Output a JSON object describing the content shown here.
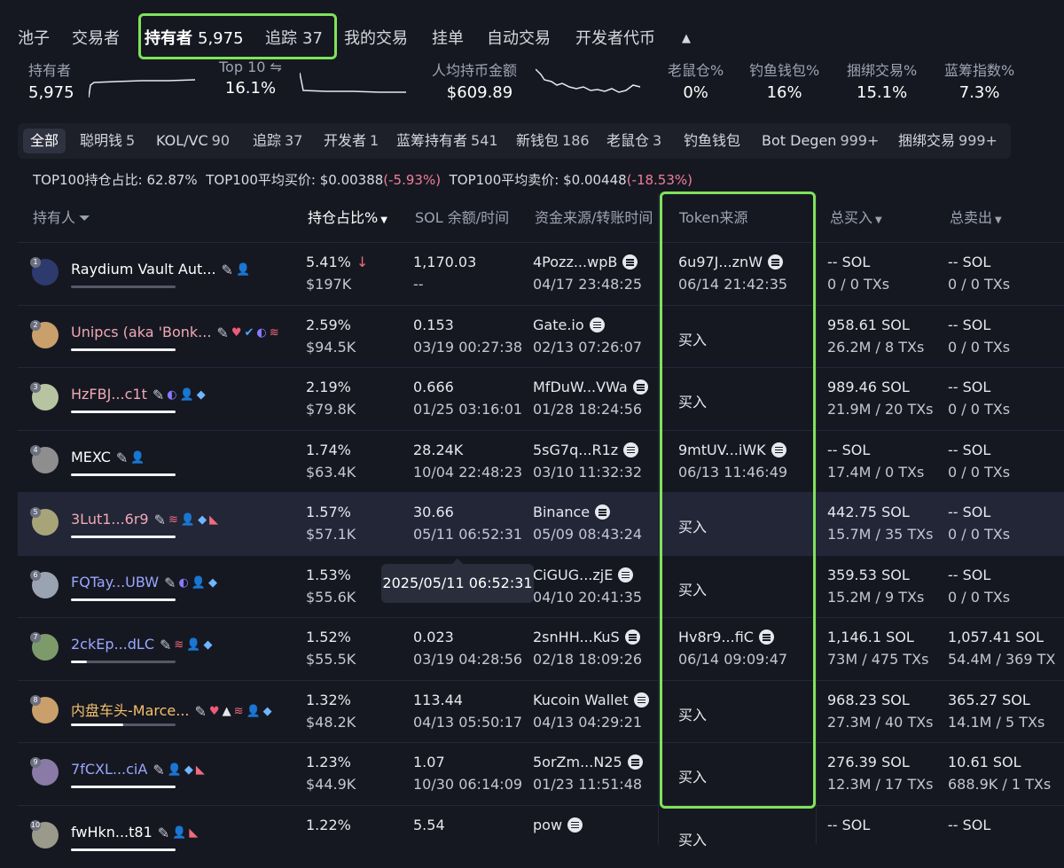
{
  "top_tabs": [
    {
      "label": "池子"
    },
    {
      "label": "交易者"
    },
    {
      "label": "持有者",
      "count": "5,975"
    },
    {
      "label": "追踪",
      "count": "37"
    },
    {
      "label": "我的交易"
    },
    {
      "label": "挂单"
    },
    {
      "label": "自动交易"
    },
    {
      "label": "开发者代币"
    }
  ],
  "stats": {
    "holders": {
      "label": "持有者",
      "value": "5,975"
    },
    "top10": {
      "label": "Top 10 ⇋",
      "value": "16.1%"
    },
    "avg_hold": {
      "label": "人均持币金额",
      "value": "$609.89"
    },
    "rat": {
      "label": "老鼠仓%",
      "value": "0%"
    },
    "phish": {
      "label": "钓鱼钱包%",
      "value": "16%"
    },
    "bundle": {
      "label": "捆绑交易%",
      "value": "15.1%"
    },
    "bluechip": {
      "label": "蓝筹指数%",
      "value": "7.3%"
    }
  },
  "filters": [
    {
      "label": "全部"
    },
    {
      "label": "聪明钱",
      "count": "5"
    },
    {
      "label": "KOL/VC",
      "count": "90"
    },
    {
      "label": "追踪",
      "count": "37"
    },
    {
      "label": "开发者",
      "count": "1"
    },
    {
      "label": "蓝筹持有者",
      "count": "541"
    },
    {
      "label": "新钱包",
      "count": "186"
    },
    {
      "label": "老鼠仓",
      "count": "3"
    },
    {
      "label": "钓鱼钱包"
    },
    {
      "label": "Bot Degen",
      "count": "999+"
    },
    {
      "label": "捆绑交易",
      "count": "999+"
    }
  ],
  "summary": {
    "share_label": "TOP100持仓占比:",
    "share": "62.87%",
    "avg_buy_label": "TOP100平均买价:",
    "avg_buy": "$0.00388",
    "avg_buy_chg": "(-5.93%)",
    "avg_sell_label": "TOP100平均卖价:",
    "avg_sell": "$0.00448",
    "avg_sell_chg": "(-18.53%)"
  },
  "headers": {
    "holder": "持有人",
    "share": "持仓占比%",
    "sol": "SOL 余额/时间",
    "funding": "资金来源/转账时间",
    "token_source": "Token来源",
    "total_buy": "总买入",
    "total_sell": "总卖出"
  },
  "tooltip": "2025/05/11 06:52:31",
  "rows": [
    {
      "rank": "1",
      "name": "Raydium Vault Aut...",
      "name_color": "#ffffff",
      "bar": 0,
      "pct": "5.41%",
      "usd": "$197K",
      "sol": "1,170.03",
      "sol_time": "--",
      "fund": "4Pozz...wpB",
      "fund_time": "04/17 23:48:25",
      "tok": "6u97J...znW",
      "tok_time": "06/14 21:42:35",
      "buy": "-- SOL",
      "buy_sub": "0 / 0 TXs",
      "sell": "-- SOL",
      "sell_sub": "0 / 0 TXs",
      "icons": [
        "person"
      ]
    },
    {
      "rank": "2",
      "name": "Unipcs (aka 'Bonk...",
      "name_color": "#f0a8b6",
      "bar": 1,
      "pct": "2.59%",
      "usd": "$94.5K",
      "sol": "0.153",
      "sol_time": "03/19 00:27:38",
      "fund": "Gate.io",
      "fund_time": "02/13 07:26:07",
      "tok": "买入",
      "tok_time": "",
      "buy": "958.61 SOL",
      "buy_sub": "26.2M / 8 TXs",
      "sell": "-- SOL",
      "sell_sub": "0 / 0 TXs",
      "icons": [
        "heart",
        "verified",
        "moon",
        "stack"
      ]
    },
    {
      "rank": "3",
      "name": "HzFBJ...c1t",
      "name_color": "#f0a8b6",
      "bar": 1,
      "pct": "2.19%",
      "usd": "$79.8K",
      "sol": "0.666",
      "sol_time": "01/25 03:16:01",
      "fund": "MfDuW...VWa",
      "fund_time": "01/28 18:24:56",
      "tok": "买入",
      "tok_time": "",
      "buy": "989.46 SOL",
      "buy_sub": "21.9M / 20 TXs",
      "sell": "-- SOL",
      "sell_sub": "0 / 0 TXs",
      "icons": [
        "moon",
        "person",
        "diamond"
      ]
    },
    {
      "rank": "4",
      "name": "MEXC",
      "name_color": "#ffffff",
      "bar": 1,
      "pct": "1.74%",
      "usd": "$63.4K",
      "sol": "28.24K",
      "sol_time": "10/04 22:48:23",
      "fund": "5sG7q...R1z",
      "fund_time": "03/10 11:32:32",
      "tok": "9mtUV...iWK",
      "tok_time": "06/13 11:46:49",
      "buy": "-- SOL",
      "buy_sub": "17.4M / 0 TXs",
      "sell": "-- SOL",
      "sell_sub": "0 / 0 TXs",
      "icons": [
        "person"
      ]
    },
    {
      "rank": "5",
      "name": "3Lut1...6r9",
      "name_color": "#f0a8b6",
      "bar": 1,
      "pct": "1.57%",
      "usd": "$57.1K",
      "sol": "30.66",
      "sol_time": "05/11 06:52:31",
      "fund": "Binance",
      "fund_time": "05/09 08:43:24",
      "tok": "买入",
      "tok_time": "",
      "buy": "442.75 SOL",
      "buy_sub": "15.7M / 35 TXs",
      "sell": "-- SOL",
      "sell_sub": "0 / 0 TXs",
      "icons": [
        "stack",
        "person",
        "diamond",
        "fish"
      ]
    },
    {
      "rank": "6",
      "name": "FQTay...UBW",
      "name_color": "#9aa6ff",
      "bar": 1,
      "pct": "1.53%",
      "usd": "$55.6K",
      "sol": "",
      "sol_time": "",
      "fund": "CiGUG...zjE",
      "fund_time": "04/10 20:41:35",
      "tok": "买入",
      "tok_time": "",
      "buy": "359.53 SOL",
      "buy_sub": "15.2M / 9 TXs",
      "sell": "-- SOL",
      "sell_sub": "0 / 0 TXs",
      "icons": [
        "moon",
        "person",
        "diamond"
      ]
    },
    {
      "rank": "7",
      "name": "2ckEp...dLC",
      "name_color": "#9aa6ff",
      "bar": 0.15,
      "pct": "1.52%",
      "usd": "$55.5K",
      "sol": "0.023",
      "sol_time": "03/19 04:28:56",
      "fund": "2snHH...KuS",
      "fund_time": "02/18 18:09:26",
      "tok": "Hv8r9...fiC",
      "tok_time": "06/14 09:09:47",
      "buy": "1,146.1 SOL",
      "buy_sub": "73M / 475 TXs",
      "sell": "1,057.41 SOL",
      "sell_sub": "54.4M / 369 TX",
      "icons": [
        "stack",
        "person",
        "diamond"
      ]
    },
    {
      "rank": "8",
      "name": "内盘车头-Marce...",
      "name_color": "#f2c06b",
      "bar": 0.5,
      "pct": "1.32%",
      "usd": "$48.2K",
      "sol": "113.44",
      "sol_time": "04/13 05:50:17",
      "fund": "Kucoin Wallet",
      "fund_time": "04/13 04:29:21",
      "tok": "买入",
      "tok_time": "",
      "buy": "968.23 SOL",
      "buy_sub": "27.3M / 40 TXs",
      "sell": "365.27 SOL",
      "sell_sub": "14.1M / 5 TXs",
      "icons": [
        "heart",
        "tri",
        "stack",
        "person",
        "diamond"
      ]
    },
    {
      "rank": "9",
      "name": "7fCXL...ciA",
      "name_color": "#9aa6ff",
      "bar": 1,
      "pct": "1.23%",
      "usd": "$44.9K",
      "sol": "1.07",
      "sol_time": "10/30 06:14:09",
      "fund": "5orZm...N25",
      "fund_time": "01/23 11:51:48",
      "tok": "买入",
      "tok_time": "",
      "buy": "276.39 SOL",
      "buy_sub": "12.3M / 17 TXs",
      "sell": "10.61 SOL",
      "sell_sub": "688.9K / 1 TXs",
      "icons": [
        "person",
        "diamond",
        "fish"
      ]
    },
    {
      "rank": "10",
      "name": "fwHkn...t81",
      "name_color": "#ffffff",
      "bar": 1,
      "pct": "1.22%",
      "usd": "",
      "sol": "5.54",
      "sol_time": "",
      "fund": "pow",
      "fund_time": "",
      "tok": "买入",
      "tok_time": "",
      "buy": "-- SOL",
      "buy_sub": "",
      "sell": "-- SOL",
      "sell_sub": "",
      "icons": [
        "person",
        "fish"
      ]
    }
  ]
}
